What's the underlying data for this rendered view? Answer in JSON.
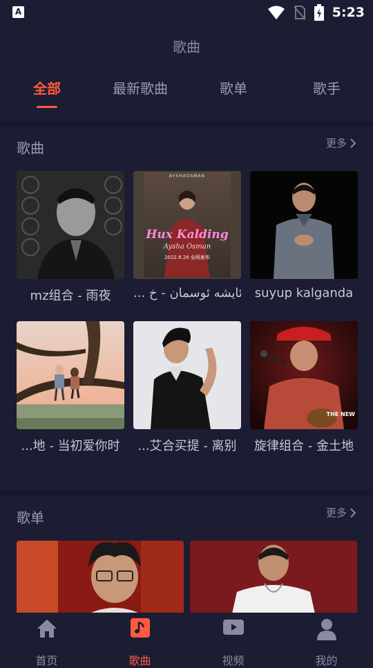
{
  "status": {
    "app_glyph": "A",
    "time": "5:23"
  },
  "header": {
    "title": "歌曲"
  },
  "tabs": [
    {
      "label": "全部",
      "active": true
    },
    {
      "label": "最新歌曲",
      "active": false
    },
    {
      "label": "歌单",
      "active": false
    },
    {
      "label": "歌手",
      "active": false
    }
  ],
  "songs_section": {
    "title": "歌曲",
    "more": "更多",
    "items": [
      {
        "caption": "mz组合 - 雨夜"
      },
      {
        "caption": "... ئايشە ئوسمان - خ",
        "poster_title": "Hux Kalding",
        "poster_artist": "Aysha Osman",
        "poster_top": "AYSHAOSMAN",
        "poster_date": "2022.8.26 全网发布"
      },
      {
        "caption": "suyup kalganda"
      },
      {
        "caption": "...地 - 当初爱你时"
      },
      {
        "caption": "...艾合买提 - 离别"
      },
      {
        "caption": "旋律组合 - 金土地",
        "poster_text": "THE NEW"
      }
    ]
  },
  "playlists_section": {
    "title": "歌单",
    "more": "更多"
  },
  "bottom_nav": [
    {
      "label": "首页",
      "icon": "home-icon",
      "active": false
    },
    {
      "label": "歌曲",
      "icon": "music-note-icon",
      "active": true
    },
    {
      "label": "视频",
      "icon": "video-icon",
      "active": false
    },
    {
      "label": "我的",
      "icon": "user-icon",
      "active": false
    }
  ],
  "colors": {
    "accent": "#ff5a3c",
    "background": "#1c1c33"
  }
}
